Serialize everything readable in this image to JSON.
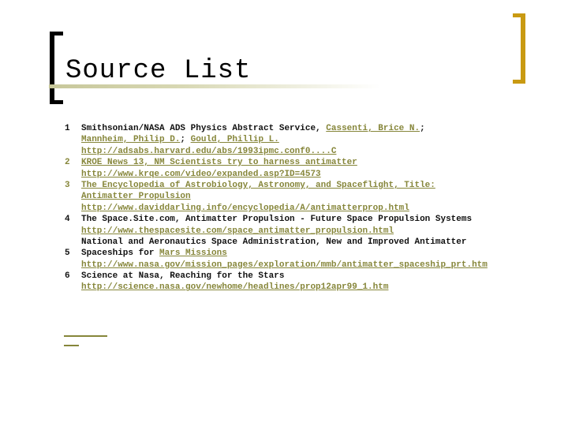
{
  "slide": {
    "title": "Source List",
    "colors": {
      "link": "#86863a",
      "accent_bracket": "#c99a12",
      "text": "#111111"
    }
  },
  "sources": [
    {
      "number": "1",
      "text_prefix": "Smithsonian/NASA ADS Physics Abstract Service, ",
      "authors": [
        "Cassenti, Brice N.",
        "Mannheim, Philip D.",
        "Gould, Phillip L."
      ],
      "url": "http://adsabs.harvard.edu/abs/1993ipmc.conf0....C"
    },
    {
      "number": "2",
      "title": "KROE News 13, NM Scientists try to harness antimatter",
      "url": "http://www.krqe.com/video/expanded.asp?ID=4573"
    },
    {
      "number": "3",
      "title_line1": "The Encyclopedia of Astrobiology, Astronomy, and Spaceflight, Title:",
      "title_line2": "Antimatter Propulsion",
      "url": "http://www.daviddarling.info/encyclopedia/A/antimatterprop.html"
    },
    {
      "number": "4",
      "text": "The Space.Site.com, Antimatter Propulsion - Future Space Propulsion Systems",
      "url": "http://www.thespacesite.com/space_antimatter_propulsion.html"
    },
    {
      "number": "5",
      "text_line1": "National and Aeronautics Space Administration, New and Improved Antimatter",
      "text_line2_prefix": "Spaceships for ",
      "text_line2_link": "Mars Missions",
      "url": "http://www.nasa.gov/mission_pages/exploration/mmb/antimatter_spaceship_prt.htm"
    },
    {
      "number": "6",
      "text": "Science at Nasa, Reaching for the Stars",
      "url": "http://science.nasa.gov/newhome/headlines/prop12apr99_1.htm"
    }
  ],
  "separators": {
    "semicolon": "; ",
    "comma": ", "
  }
}
